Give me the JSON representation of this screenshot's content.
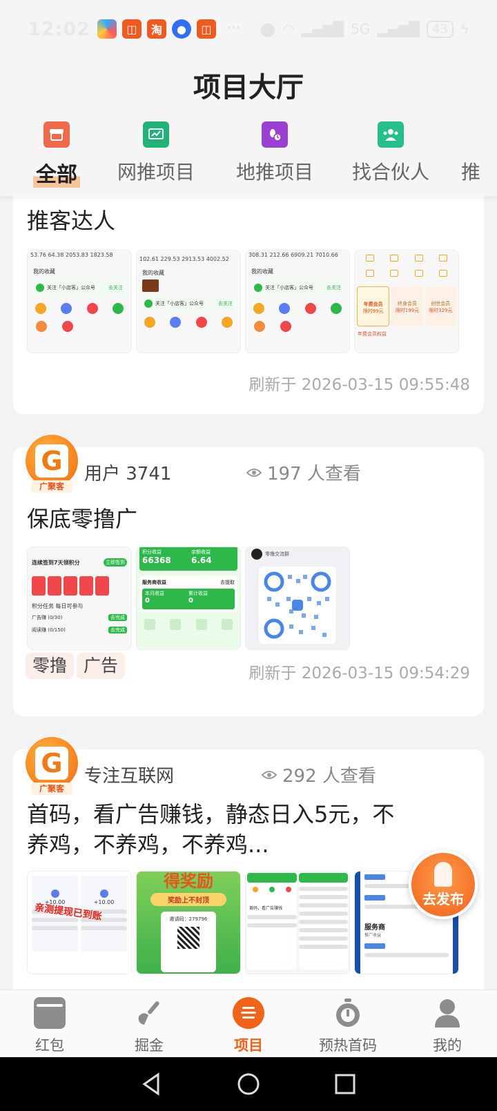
{
  "status_bar": {
    "time": "12:02",
    "more": "···",
    "network": "5G",
    "battery": "43"
  },
  "header": {
    "title": "项目大厅",
    "tabs": [
      {
        "label": "全部",
        "icon": "store-icon",
        "active": true
      },
      {
        "label": "网推项目",
        "icon": "chart-icon",
        "active": false
      },
      {
        "label": "地推项目",
        "icon": "footprint-clock-icon",
        "active": false
      },
      {
        "label": "找合伙人",
        "icon": "people-icon",
        "active": false
      },
      {
        "label": "推",
        "icon": "",
        "active": false
      }
    ]
  },
  "cards": [
    {
      "title": "推客达人",
      "refresh": "刷新于 2026-03-15 09:55:48",
      "thumb_texts": [
        {
          "stats": "53.76  64.38  2053.83 1823.58",
          "section": "我的收藏",
          "wechat": "关注「小店客」公众号",
          "follow": "去关注"
        },
        {
          "stats": "102.61  229.53  2913.53  4002.52",
          "section": "我的收藏",
          "wechat": "关注「小店客」公众号",
          "follow": "去关注"
        },
        {
          "stats": "308.31  212.66  6909.21 7010.66",
          "section": "我的收藏",
          "wechat": "关注「小店客」公众号",
          "follow": "去关注"
        },
        {
          "member_a": "年费会员",
          "member_b": "终身会员",
          "member_c": "创世会员",
          "price_a": "限时99元",
          "price_b": "限时199元",
          "price_c": "限时329元",
          "footer": "年费会员权益"
        }
      ]
    },
    {
      "username": "用户 3741",
      "avatar_tag": "广聚客",
      "views": "197 人查看",
      "title": "保底零撸广",
      "tags": [
        "零撸",
        "广告"
      ],
      "refresh": "刷新于 2026-03-15 09:54:29",
      "thumb_texts": [
        {
          "head": "连续签到7天领积分",
          "btn": "立即签到",
          "task": "积分任务  每日可参与",
          "row1": "广告赚 (0/30)",
          "row2": "阅读赚 (0/150)",
          "row_btn": "去完成"
        },
        {
          "points_label": "积分收益",
          "points": "66368",
          "balance_label": "余额收益",
          "balance": "6.64",
          "svc": "服务商收益",
          "svc_btn": "去提取",
          "month": "本月收益",
          "total": "累计收益",
          "zero": "0"
        },
        {
          "group": "零撸交流群"
        }
      ]
    },
    {
      "username": "专注互联网",
      "avatar_tag": "广聚客",
      "views": "292 人查看",
      "title": "首码，看广告赚钱，静态日入5元，不养鸡，不养鸡，不养鸡...",
      "thumb_texts": [
        {
          "stamp": "亲测提现已到账",
          "amount": "+10.00"
        },
        {
          "banner": "得奖励",
          "sub": "奖励上不封顶",
          "code_label": "邀请码：",
          "code": "279796"
        },
        {
          "note": "首码，看广告赚钱"
        },
        {
          "svc": "服务商",
          "sub": "推广收益"
        }
      ]
    }
  ],
  "fab": {
    "label": "去发布"
  },
  "bottom_nav": [
    {
      "label": "红包",
      "icon": "red-packet-icon",
      "active": false
    },
    {
      "label": "掘金",
      "icon": "shovel-icon",
      "active": false
    },
    {
      "label": "项目",
      "icon": "project-icon",
      "active": true
    },
    {
      "label": "预热首码",
      "icon": "stopwatch-icon",
      "active": false
    },
    {
      "label": "我的",
      "icon": "person-icon",
      "active": false
    }
  ],
  "colors": {
    "accent": "#f06318",
    "tag_bg": "#fbeee8",
    "refresh_text": "#aaaaaa"
  }
}
